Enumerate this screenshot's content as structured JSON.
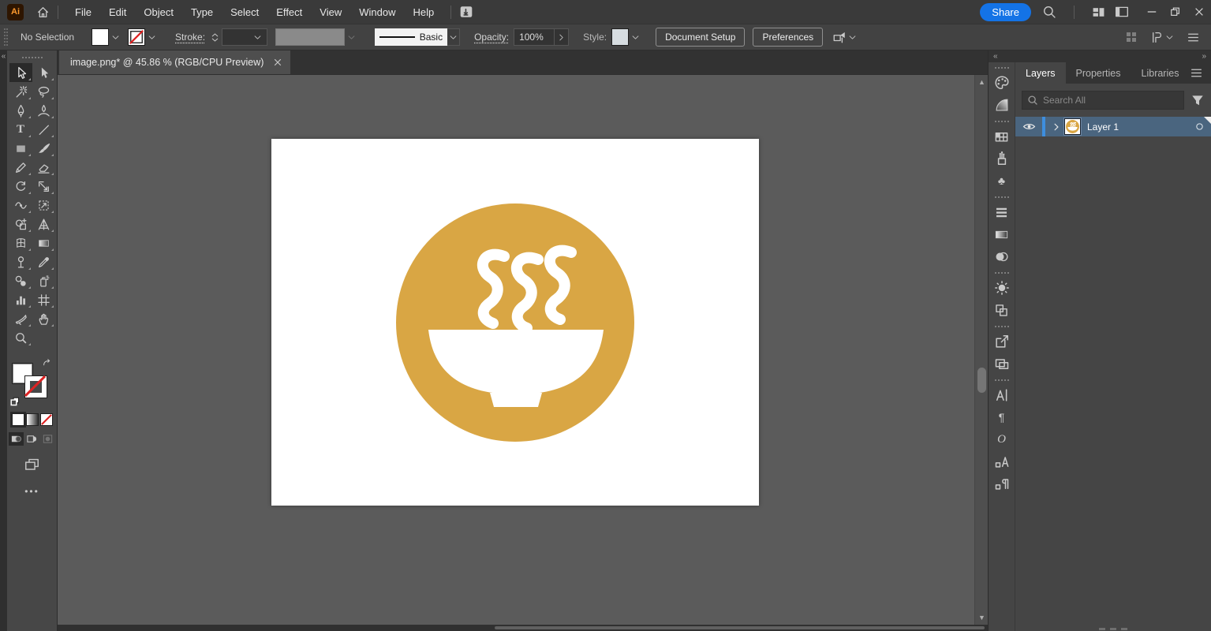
{
  "titlebar": {
    "app_icon_label": "Ai",
    "menu_items": [
      "File",
      "Edit",
      "Object",
      "Type",
      "Select",
      "Effect",
      "View",
      "Window",
      "Help"
    ],
    "share_label": "Share",
    "icon_names": [
      "home-icon",
      "touch-workspace-icon",
      "search-icon",
      "arrange-documents-icon",
      "workspace-switcher-icon",
      "minimize-icon",
      "restore-icon",
      "close-icon"
    ]
  },
  "control_bar": {
    "selection_status": "No Selection",
    "stroke_label": "Stroke:",
    "brush_name": "Basic",
    "opacity_label": "Opacity:",
    "opacity_value": "100%",
    "style_label": "Style:",
    "document_setup_label": "Document Setup",
    "preferences_label": "Preferences"
  },
  "document_tab": {
    "title": "image.png* @ 45.86 % (RGB/CPU Preview)"
  },
  "tools": [
    {
      "name": "selection-tool",
      "icon": "selection",
      "selected": true
    },
    {
      "name": "direct-selection-tool",
      "icon": "direct-selection",
      "selected": false
    },
    {
      "name": "magic-wand-tool",
      "icon": "magic-wand",
      "selected": false
    },
    {
      "name": "lasso-tool",
      "icon": "lasso",
      "selected": false
    },
    {
      "name": "pen-tool",
      "icon": "pen",
      "selected": false
    },
    {
      "name": "curvature-tool",
      "icon": "curvature",
      "selected": false
    },
    {
      "name": "type-tool",
      "icon": "type",
      "selected": false
    },
    {
      "name": "line-segment-tool",
      "icon": "line",
      "selected": false
    },
    {
      "name": "rectangle-tool",
      "icon": "rectangle",
      "selected": false
    },
    {
      "name": "paintbrush-tool",
      "icon": "paintbrush",
      "selected": false
    },
    {
      "name": "shaper-tool",
      "icon": "pencil",
      "selected": false
    },
    {
      "name": "eraser-tool",
      "icon": "eraser",
      "selected": false
    },
    {
      "name": "rotate-tool",
      "icon": "rotate",
      "selected": false
    },
    {
      "name": "scale-tool",
      "icon": "scale",
      "selected": false
    },
    {
      "name": "width-tool",
      "icon": "width",
      "selected": false
    },
    {
      "name": "free-transform-tool",
      "icon": "free-transform",
      "selected": false
    },
    {
      "name": "shape-builder-tool",
      "icon": "shape-builder",
      "selected": false
    },
    {
      "name": "perspective-grid-tool",
      "icon": "perspective-grid",
      "selected": false
    },
    {
      "name": "mesh-tool",
      "icon": "mesh",
      "selected": false
    },
    {
      "name": "gradient-tool",
      "icon": "gradient",
      "selected": false
    },
    {
      "name": "puppet-warp-tool",
      "icon": "puppet-warp",
      "selected": false
    },
    {
      "name": "eyedropper-tool",
      "icon": "eyedropper",
      "selected": false
    },
    {
      "name": "blend-tool",
      "icon": "blend",
      "selected": false
    },
    {
      "name": "symbol-sprayer-tool",
      "icon": "symbol-sprayer",
      "selected": false
    },
    {
      "name": "column-graph-tool",
      "icon": "column-graph",
      "selected": false
    },
    {
      "name": "artboard-tool",
      "icon": "artboard",
      "selected": false
    },
    {
      "name": "slice-tool",
      "icon": "slice",
      "selected": false
    },
    {
      "name": "hand-tool",
      "icon": "hand",
      "selected": false
    },
    {
      "name": "zoom-tool",
      "icon": "zoom",
      "selected": false
    }
  ],
  "canvas": {
    "artboard_content": "steaming-soup-bowl-badge",
    "badge_color": "#D9A644",
    "glyph_color": "#FFFFFF"
  },
  "dock_groups": [
    [
      {
        "name": "color-panel",
        "icon": "palette"
      },
      {
        "name": "color-guide-panel",
        "icon": "color-guide"
      }
    ],
    [
      {
        "name": "swatches-panel",
        "icon": "swatches"
      },
      {
        "name": "brushes-panel",
        "icon": "brushes"
      },
      {
        "name": "symbols-panel",
        "icon": "symbols"
      }
    ],
    [
      {
        "name": "stroke-panel",
        "icon": "stroke-lines"
      },
      {
        "name": "gradient-panel",
        "icon": "gradient-rect"
      },
      {
        "name": "transparency-panel",
        "icon": "transparency"
      }
    ],
    [
      {
        "name": "appearance-panel",
        "icon": "appearance"
      },
      {
        "name": "graphic-styles-panel",
        "icon": "graphic-styles"
      }
    ],
    [
      {
        "name": "export-panel",
        "icon": "export"
      },
      {
        "name": "artboards-panel",
        "icon": "artboards"
      }
    ],
    [
      {
        "name": "character-panel",
        "icon": "character"
      },
      {
        "name": "paragraph-panel",
        "icon": "paragraph"
      },
      {
        "name": "opentype-panel",
        "icon": "opentype"
      },
      {
        "name": "character-styles-panel",
        "icon": "character-styles"
      },
      {
        "name": "paragraph-styles-panel",
        "icon": "paragraph-styles"
      }
    ]
  ],
  "layers_panel": {
    "tabs": [
      {
        "label": "Layers",
        "active": true
      },
      {
        "label": "Properties",
        "active": false
      },
      {
        "label": "Libraries",
        "active": false
      }
    ],
    "search_placeholder": "Search All",
    "layers": [
      {
        "name": "Layer 1",
        "selected": true
      }
    ]
  },
  "colors": {
    "accent_blue": "#1473E6",
    "selection_row_blue": "#4A657F",
    "selection_accent_blue": "#3E8EDE",
    "badge_gold": "#D9A644",
    "pasteboard_gray": "#5B5B5B"
  }
}
